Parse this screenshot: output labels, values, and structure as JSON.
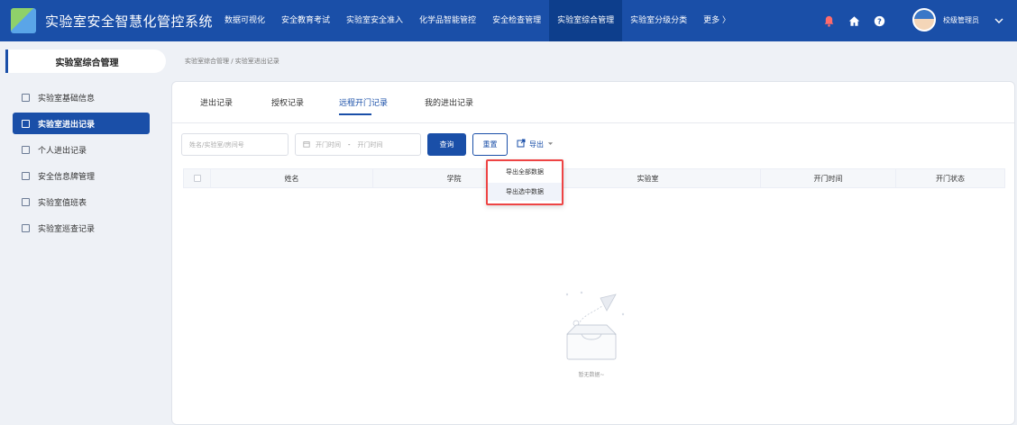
{
  "app": {
    "title": "实验室安全智慧化管控系统"
  },
  "nav": {
    "items": [
      {
        "label": "数据可视化"
      },
      {
        "label": "安全教育考试"
      },
      {
        "label": "实验室安全准入"
      },
      {
        "label": "化学品智能管控"
      },
      {
        "label": "安全检查管理"
      },
      {
        "label": "实验室综合管理",
        "active": true
      },
      {
        "label": "实验室分级分类"
      },
      {
        "label": "更多 〉"
      }
    ]
  },
  "user": {
    "name": "校级管理员"
  },
  "sidebar": {
    "header": "实验室综合管理",
    "items": [
      {
        "label": "实验室基础信息"
      },
      {
        "label": "实验室进出记录",
        "active": true
      },
      {
        "label": "个人进出记录"
      },
      {
        "label": "安全信息牌管理"
      },
      {
        "label": "实验室值班表"
      },
      {
        "label": "实验室巡查记录"
      }
    ]
  },
  "breadcrumb": {
    "text": "实验室综合管理 / 实验室进出记录"
  },
  "tabs": [
    {
      "label": "进出记录"
    },
    {
      "label": "授权记录"
    },
    {
      "label": "远程开门记录",
      "active": true
    },
    {
      "label": "我的进出记录"
    }
  ],
  "filters": {
    "search_placeholder": "姓名/实验室/房间号",
    "date_start": "开门时间",
    "date_sep": "-",
    "date_end": "开门时间",
    "query_label": "查询",
    "reset_label": "重置",
    "export_label": "导出"
  },
  "table": {
    "columns": [
      "姓名",
      "学院",
      "实验室",
      "开门时间",
      "开门状态"
    ]
  },
  "empty": {
    "text": "暂无数据~"
  },
  "export_menu": {
    "items": [
      "导出全部数据",
      "导出选中数据"
    ]
  },
  "colors": {
    "primary": "#1a4fa8",
    "highlight_border": "#ee4444"
  }
}
